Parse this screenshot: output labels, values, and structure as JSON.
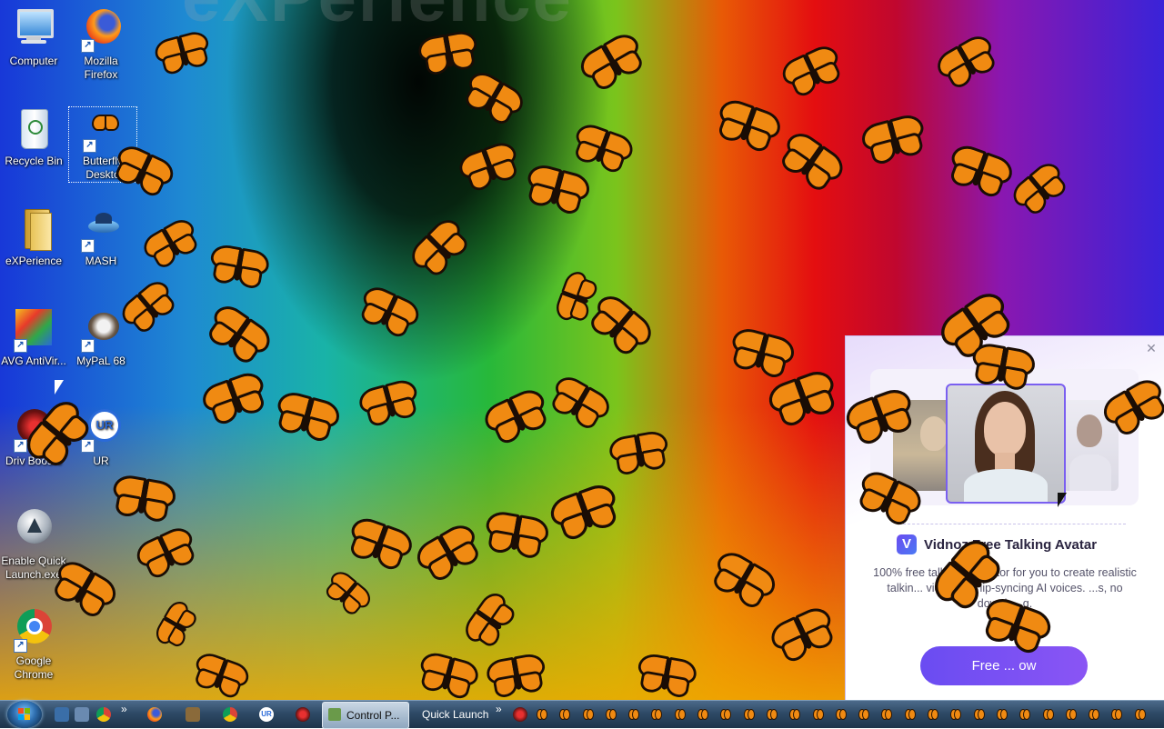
{
  "desktop": {
    "wallpaper_text": "eXPerience",
    "icons": [
      {
        "label": "Computer",
        "icon": "computer-icon"
      },
      {
        "label": "Mozilla Firefox",
        "icon": "firefox-icon"
      },
      {
        "label": "Recycle Bin",
        "icon": "recycle-bin-icon"
      },
      {
        "label": "Butterfly Deskto",
        "icon": "butterfly-icon"
      },
      {
        "label": "eXPerience",
        "icon": "folder-icon"
      },
      {
        "label": "MASH",
        "icon": "mash-icon"
      },
      {
        "label": "AVG AntiVir...",
        "icon": "avg-icon"
      },
      {
        "label": "MyPaL 68",
        "icon": "raccoon-icon"
      },
      {
        "label": "Driv Booste",
        "icon": "driver-booster-icon"
      },
      {
        "label": "UR",
        "icon": "ur-browser-icon"
      },
      {
        "label": "Enable Quick Launch.exe",
        "icon": "quick-launch-icon"
      },
      {
        "label": "Google Chrome",
        "icon": "chrome-icon"
      }
    ]
  },
  "popup": {
    "title": "Vidnoz Free Talking Avatar",
    "description": "100% free talki... generator for you to create realistic talkin... video with lip-syncing AI voices. ...s, no downlo...g.",
    "cta_label": "Free ... ow",
    "close_glyph": "✕",
    "logo_letter": "V"
  },
  "taskbar": {
    "start_icon": "windows-orb",
    "quick_launch": [
      "desktop-icon",
      "explorer-icon",
      "chrome-icon"
    ],
    "chevron": "»",
    "pinned": [
      "firefox-icon",
      "butterfly-app-icon",
      "chrome-icon",
      "ur-browser-icon",
      "driver-booster-icon"
    ],
    "active_window": "Control P...",
    "toolbar_label": "Quick Launch",
    "tray_icons": [
      "driver-booster-tray-icon",
      "butterfly-tray-icon"
    ]
  },
  "colors": {
    "accent_purple": "#7a5ff0",
    "butterfly_orange": "#f08a12",
    "taskbar_dark": "#1d344a"
  }
}
